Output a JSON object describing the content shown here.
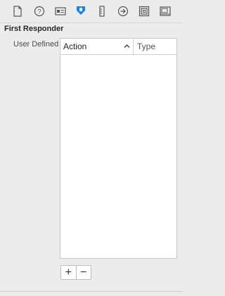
{
  "toolbar": {
    "icons": [
      {
        "name": "file-inspector-icon"
      },
      {
        "name": "quick-help-icon"
      },
      {
        "name": "identity-inspector-icon"
      },
      {
        "name": "attributes-inspector-icon",
        "selected": true
      },
      {
        "name": "size-inspector-icon"
      },
      {
        "name": "connections-inspector-icon"
      },
      {
        "name": "bindings-inspector-icon"
      },
      {
        "name": "view-effects-icon"
      }
    ],
    "accent_color": "#1a7ff0"
  },
  "section": {
    "title": "First Responder",
    "row_label": "User Defined"
  },
  "table": {
    "columns": [
      "Action",
      "Type"
    ],
    "rows": []
  },
  "buttons": {
    "add_label": "+",
    "remove_label": "−"
  }
}
